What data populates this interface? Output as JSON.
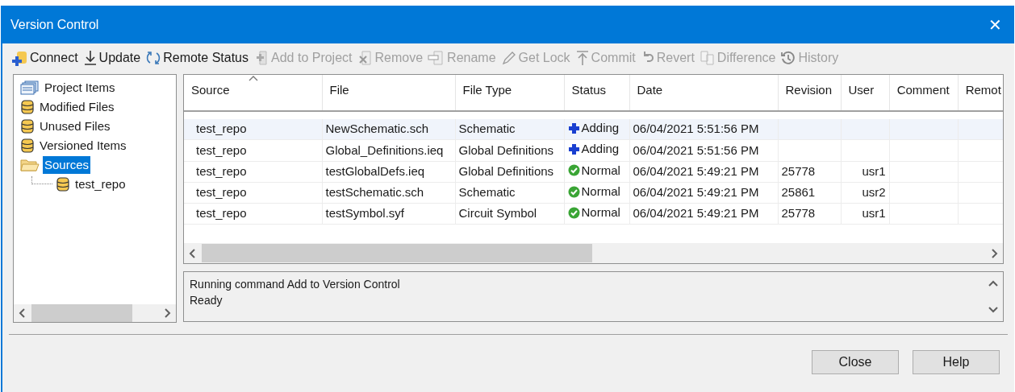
{
  "window": {
    "title": "Version Control",
    "close": "✕"
  },
  "toolbar": [
    {
      "label": "Connect",
      "disabled": false
    },
    {
      "label": "Update",
      "disabled": false
    },
    {
      "label": "Remote Status",
      "disabled": false
    },
    {
      "label": "Add to Project",
      "disabled": true
    },
    {
      "label": "Remove",
      "disabled": true
    },
    {
      "label": "Rename",
      "disabled": true
    },
    {
      "label": "Get Lock",
      "disabled": true
    },
    {
      "label": "Commit",
      "disabled": true
    },
    {
      "label": "Revert",
      "disabled": true
    },
    {
      "label": "Difference",
      "disabled": true
    },
    {
      "label": "History",
      "disabled": true
    }
  ],
  "tree": [
    {
      "label": "Project Items",
      "selected": false
    },
    {
      "label": "Modified Files",
      "selected": false
    },
    {
      "label": "Unused Files",
      "selected": false
    },
    {
      "label": "Versioned Items",
      "selected": false
    },
    {
      "label": "Sources",
      "selected": true,
      "children": [
        {
          "label": "test_repo",
          "selected": false
        }
      ]
    }
  ],
  "table": {
    "columns": [
      "Source",
      "File",
      "File Type",
      "Status",
      "Date",
      "Revision",
      "User",
      "Comment",
      "Remot"
    ],
    "rows": [
      {
        "selected": true,
        "kind": "adding",
        "cells": [
          "test_repo",
          "NewSchematic.sch",
          "Schematic",
          "Adding",
          "06/04/2021 5:51:56 PM",
          "",
          "",
          "",
          ""
        ]
      },
      {
        "selected": false,
        "kind": "adding",
        "cells": [
          "test_repo",
          "Global_Definitions.ieq",
          "Global Definitions",
          "Adding",
          "06/04/2021 5:51:56 PM",
          "",
          "",
          "",
          ""
        ]
      },
      {
        "selected": false,
        "kind": "normal",
        "cells": [
          "test_repo",
          "testGlobalDefs.ieq",
          "Global Definitions",
          "Normal",
          "06/04/2021 5:49:21 PM",
          "25778",
          "usr1",
          "",
          ""
        ]
      },
      {
        "selected": false,
        "kind": "normal",
        "cells": [
          "test_repo",
          "testSchematic.sch",
          "Schematic",
          "Normal",
          "06/04/2021 5:49:21 PM",
          "25861",
          "usr2",
          "",
          ""
        ]
      },
      {
        "selected": false,
        "kind": "normal",
        "cells": [
          "test_repo",
          "testSymbol.syf",
          "Circuit Symbol",
          "Normal",
          "06/04/2021 5:49:21 PM",
          "25778",
          "usr1",
          "",
          ""
        ]
      }
    ]
  },
  "log": [
    "Running command Add to Version Control",
    "Ready"
  ],
  "buttons": [
    "Close",
    "Help"
  ]
}
